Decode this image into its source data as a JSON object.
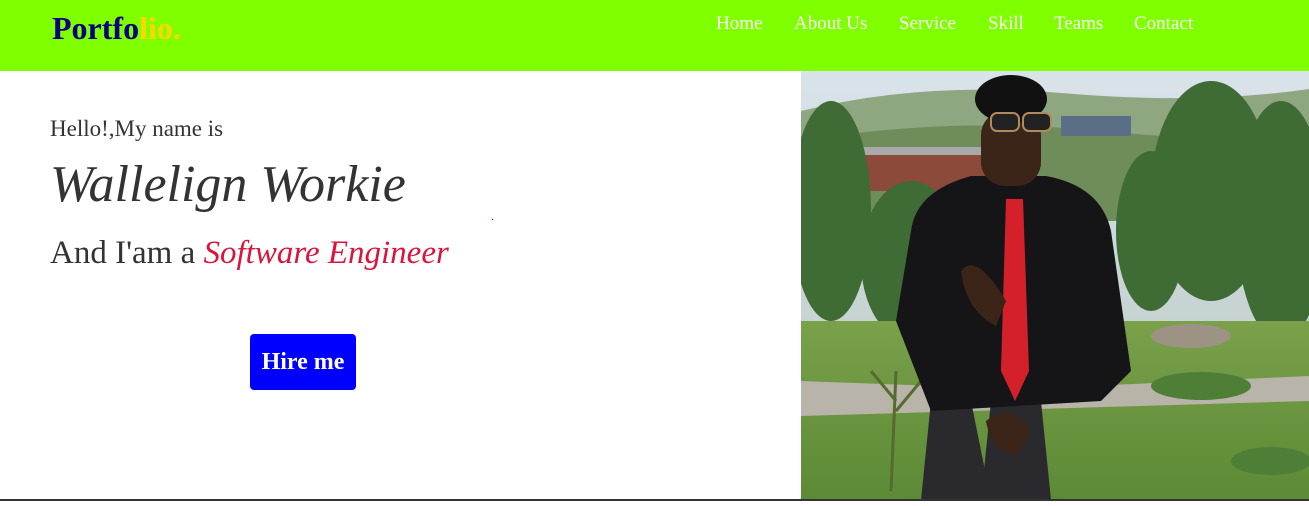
{
  "header": {
    "logo_part1": "Portfo",
    "logo_part2": "lio.",
    "logo_colors": {
      "part1": "#000080",
      "part2": "#ffd700"
    },
    "background": "#7fff00",
    "nav": {
      "home": "Home",
      "about": "About Us",
      "service": "Service",
      "skill": "Skill",
      "teams": "Teams",
      "contact": "Contact"
    }
  },
  "hero": {
    "greeting": "Hello!,My name is",
    "name": "Wallelign Workie",
    "role_prefix": "And I'am a ",
    "role_highlight": "Software Engineer",
    "highlight_color": "#dc143c",
    "hire_label": "Hire me",
    "hire_color": "#0000ff",
    "photo_icon": "profile-photo"
  }
}
